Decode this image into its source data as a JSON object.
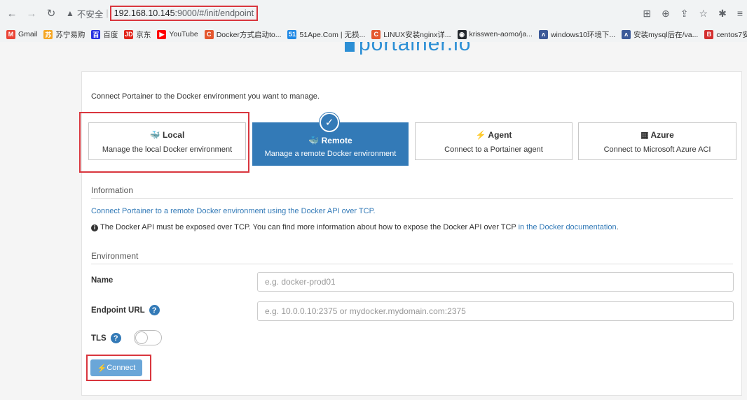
{
  "browser": {
    "insecure_label": "不安全",
    "url_host": "192.168.10.145",
    "url_rest": ":9000/#/init/endpoint",
    "bookmarks": [
      {
        "label": "Gmail",
        "icon": "M",
        "color": "#ea4335"
      },
      {
        "label": "苏宁易购",
        "icon": "苏",
        "color": "#f5a623"
      },
      {
        "label": "百度",
        "icon": "百",
        "color": "#2932e1"
      },
      {
        "label": "京东",
        "icon": "JD",
        "color": "#e1251b"
      },
      {
        "label": "YouTube",
        "icon": "▶",
        "color": "#ff0000"
      },
      {
        "label": "Docker方式启动to...",
        "icon": "C",
        "color": "#e4572e"
      },
      {
        "label": "51Ape.Com | 无损...",
        "icon": "51",
        "color": "#1e88e5"
      },
      {
        "label": "LINUX安装nginx详...",
        "icon": "C",
        "color": "#e4572e"
      },
      {
        "label": "krisswen-aomo/ja...",
        "icon": "◉",
        "color": "#24292e"
      },
      {
        "label": "windows10环境下...",
        "icon": "ʌ",
        "color": "#3b5998"
      },
      {
        "label": "安装mysql后在/va...",
        "icon": "ʌ",
        "color": "#3b5998"
      },
      {
        "label": "centos7安",
        "icon": "B",
        "color": "#d32f2f"
      }
    ]
  },
  "logo_text": "portainer.io",
  "intro": "Connect Portainer to the Docker environment you want to manage.",
  "options": [
    {
      "title": "Local",
      "desc": "Manage the local Docker environment",
      "icon": "🐳"
    },
    {
      "title": "Remote",
      "desc": "Manage a remote Docker environment",
      "icon": "🐳"
    },
    {
      "title": "Agent",
      "desc": "Connect to a Portainer agent",
      "icon": "⚡"
    },
    {
      "title": "Azure",
      "desc": "Connect to Microsoft Azure ACI",
      "icon": "▦"
    }
  ],
  "information": {
    "heading": "Information",
    "link": "Connect Portainer to a remote Docker environment using the Docker API over TCP.",
    "note": "The Docker API must be exposed over TCP. You can find more information about how to expose the Docker API over TCP ",
    "note_link": "in the Docker documentation",
    "note_end": "."
  },
  "environment": {
    "heading": "Environment",
    "name_label": "Name",
    "name_placeholder": "e.g. docker-prod01",
    "url_label": "Endpoint URL",
    "url_placeholder": "e.g. 10.0.0.10:2375 or mydocker.mydomain.com:2375",
    "tls_label": "TLS",
    "connect_label": "Connect"
  }
}
